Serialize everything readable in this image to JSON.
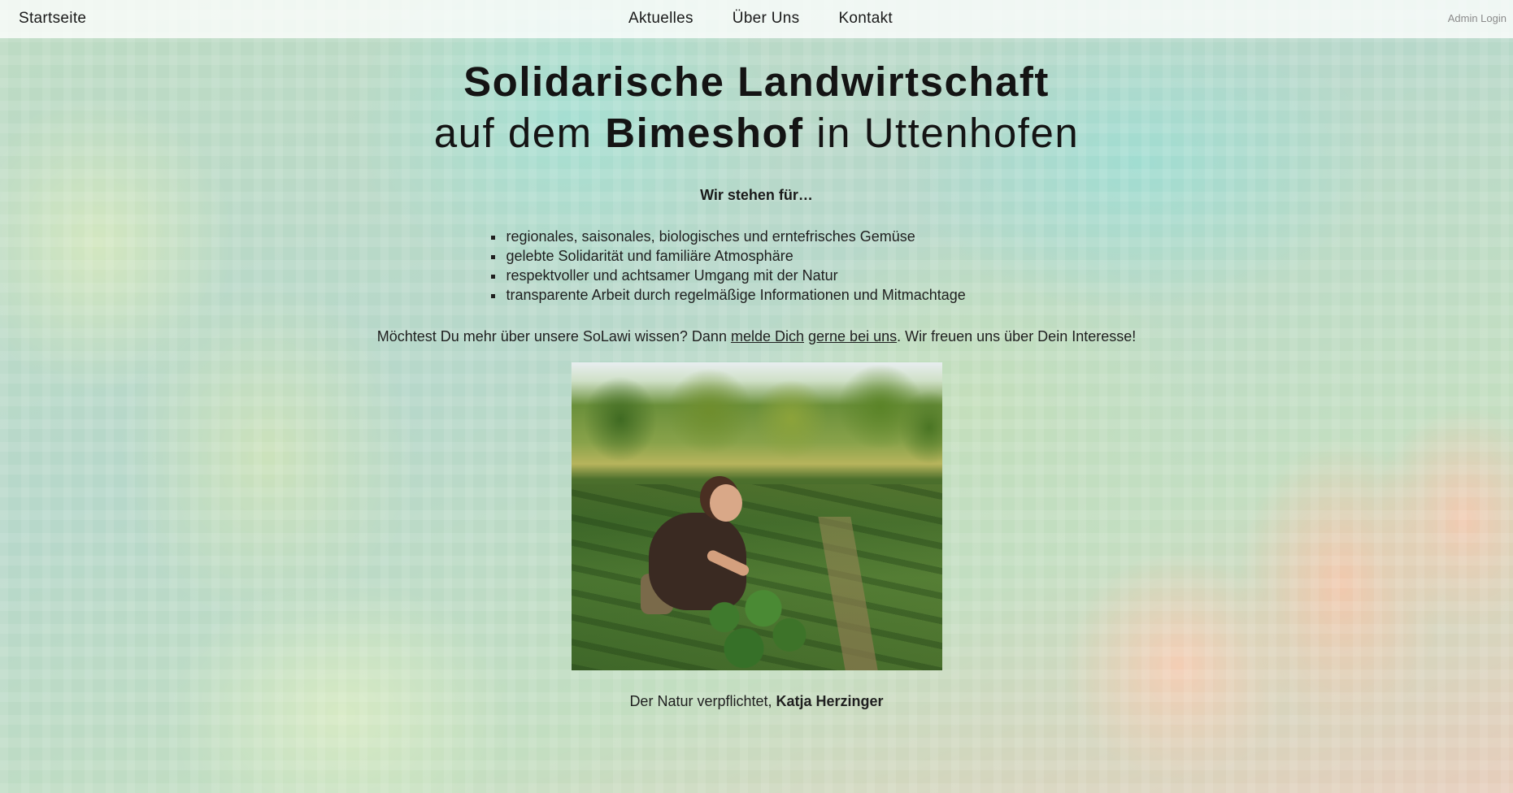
{
  "nav": {
    "brand": "Startseite",
    "links": [
      "Aktuelles",
      "Über Uns",
      "Kontakt"
    ],
    "admin_login": "Admin Login"
  },
  "hero": {
    "title_line1": "Solidarische Landwirtschaft",
    "title_line2_pre": "auf dem ",
    "title_line2_bold": "Bimeshof",
    "title_line2_post": " in Uttenhofen"
  },
  "values": {
    "heading": "Wir stehen für…",
    "items": [
      "regionales, saisonales, biologisches und erntefrisches Gemüse",
      "gelebte Solidarität und familiäre Atmosphäre",
      "respektvoller und achtsamer Umgang mit der Natur",
      "transparente Arbeit durch regelmäßige Informationen und Mitmachtage"
    ]
  },
  "contact": {
    "text_pre": "Möchtest Du mehr über unsere SoLawi wissen? Dann ",
    "link1": "melde Dich",
    "space": " ",
    "link2": "gerne bei uns",
    "text_post": ". Wir freuen uns über Dein Interesse!"
  },
  "caption": {
    "text_pre": "Der Natur verpflichtet, ",
    "name": "Katja Herzinger"
  }
}
